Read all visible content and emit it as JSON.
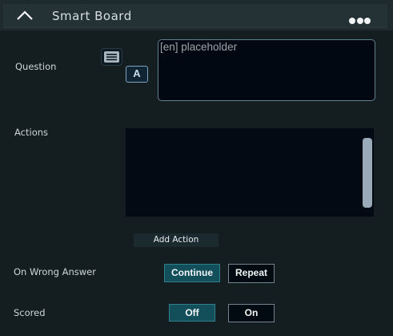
{
  "header": {
    "title": "Smart Board",
    "collapse_icon": "chevron-up-icon",
    "menu_icon": "more-dots-icon"
  },
  "question": {
    "label": "Question",
    "text_icon": "text-lines-icon",
    "font_icon_label": "A",
    "placeholder": "[en] placeholder"
  },
  "actions": {
    "label": "Actions",
    "add_button": "Add Action"
  },
  "wrong_answer": {
    "label": "On Wrong Answer",
    "options": [
      "Continue",
      "Repeat"
    ],
    "selected": "Continue"
  },
  "scored": {
    "label": "Scored",
    "options": [
      "Off",
      "On"
    ],
    "selected": "Off"
  },
  "colors": {
    "accent": "#134f5b",
    "panel_bg": "#141d20",
    "input_border": "#5e8190"
  }
}
